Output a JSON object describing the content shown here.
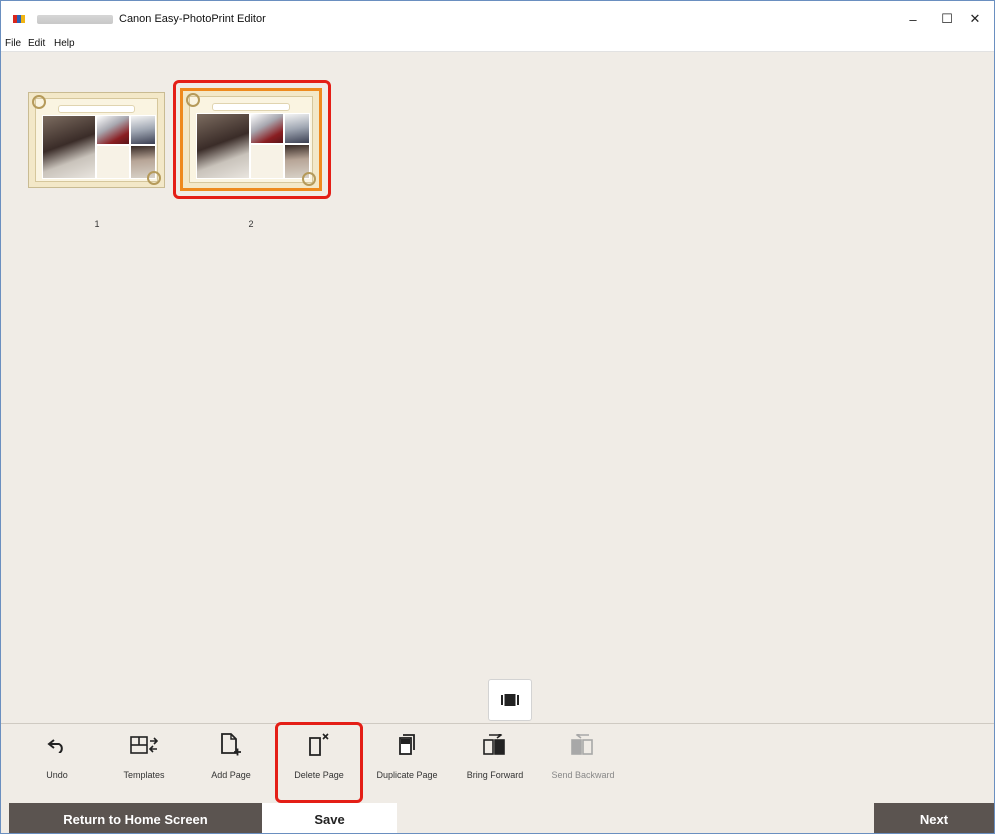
{
  "window": {
    "title": "Canon Easy-PhotoPrint Editor",
    "controls": {
      "minimize": "–",
      "maximize": "☐",
      "close": "✕"
    }
  },
  "menu": {
    "items": [
      {
        "label": "File"
      },
      {
        "label": "Edit"
      },
      {
        "label": "Help"
      }
    ]
  },
  "pages": [
    {
      "number": "1",
      "selected": false
    },
    {
      "number": "2",
      "selected": true
    }
  ],
  "toolbar": {
    "tools": [
      {
        "label": "Undo",
        "icon": "undo-icon",
        "enabled": true
      },
      {
        "label": "Templates",
        "icon": "templates-icon",
        "enabled": true
      },
      {
        "label": "Add Page",
        "icon": "add-page-icon",
        "enabled": true
      },
      {
        "label": "Delete Page",
        "icon": "delete-page-icon",
        "enabled": true,
        "highlighted": true
      },
      {
        "label": "Duplicate Page",
        "icon": "duplicate-page-icon",
        "enabled": true
      },
      {
        "label": "Bring Forward",
        "icon": "bring-forward-icon",
        "enabled": true
      },
      {
        "label": "Send Backward",
        "icon": "send-backward-icon",
        "enabled": false
      }
    ]
  },
  "view_toggle": {
    "icon": "page-list-view-icon"
  },
  "bottom": {
    "home_label": "Return to Home Screen",
    "save_label": "Save",
    "next_label": "Next"
  },
  "colors": {
    "background": "#f0ece6",
    "dark_button": "#5b5450",
    "highlight": "#e41e16",
    "selection": "#ee8a1e"
  }
}
